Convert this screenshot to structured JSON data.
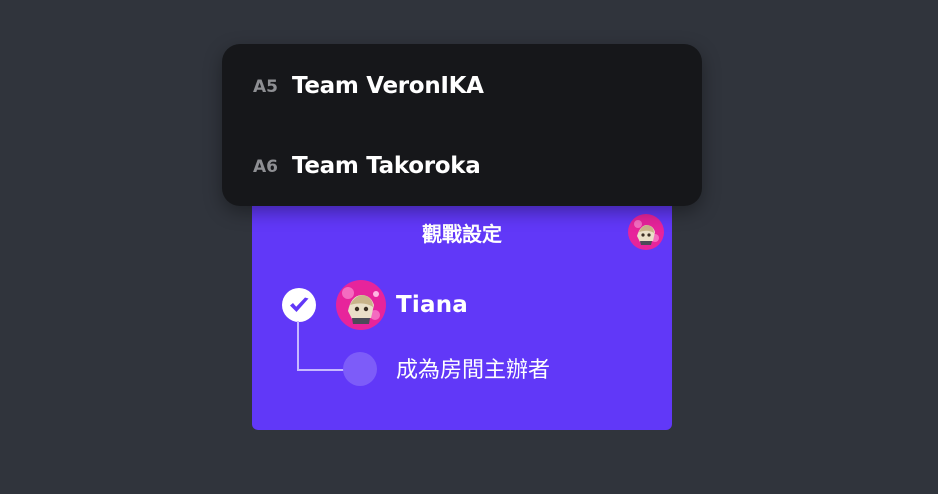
{
  "team_dropdown": {
    "items": [
      {
        "code": "A5",
        "name": "Team VeronIKA"
      },
      {
        "code": "A6",
        "name": "Team Takoroka"
      }
    ]
  },
  "spectate_settings": {
    "title": "觀戰設定",
    "avatar_icon": "player-avatar-icon",
    "player": {
      "name": "Tiana",
      "selected": true,
      "check_icon": "check-circle-icon",
      "avatar_icon": "player-avatar-icon"
    },
    "host_option": {
      "label": "成為房間主辦者",
      "selected": false
    }
  },
  "colors": {
    "background": "#30343c",
    "card": "#6138f8",
    "dropdown": "#16171a",
    "avatar_pink": "#e7249b",
    "code_gray": "#8e8f93"
  }
}
